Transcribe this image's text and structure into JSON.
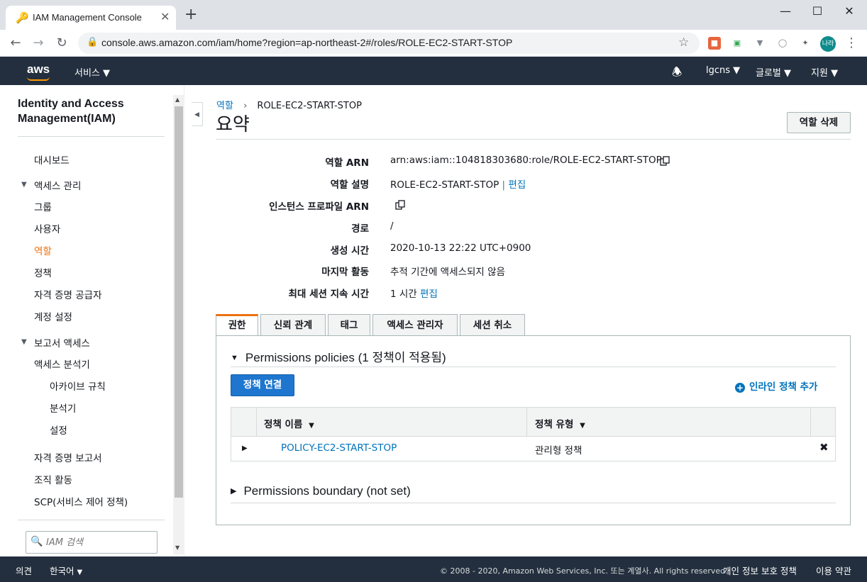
{
  "browser": {
    "tab_title": "IAM Management Console",
    "url": "console.aws.amazon.com/iam/home?region=ap-northeast-2#/roles/ROLE-EC2-START-STOP",
    "profile_label": "나라"
  },
  "aws_nav": {
    "logo": "aws",
    "services": "서비스",
    "account": "lgcns",
    "region": "글로벌",
    "support": "지원"
  },
  "sidebar": {
    "title": "Identity and Access Management(IAM)",
    "dashboard": "대시보드",
    "access_mgmt": "액세스 관리",
    "items_access": [
      "그룹",
      "사용자",
      "역할",
      "정책",
      "자격 증명 공급자",
      "계정 설정"
    ],
    "report_access": "보고서 액세스",
    "analyzer": "액세스 분석기",
    "analyzer_sub": [
      "아카이브 규칙",
      "분석기",
      "설정"
    ],
    "items_report": [
      "자격 증명 보고서",
      "조직 활동",
      "SCP(서비스 제어 정책)"
    ],
    "search_placeholder": "IAM 검색"
  },
  "breadcrumb": {
    "parent": "역할",
    "current": "ROLE-EC2-START-STOP"
  },
  "page_title": "요약",
  "delete_button": "역할 삭제",
  "summary": {
    "arn_label": "역할 ARN",
    "arn_value": "arn:aws:iam::104818303680:role/ROLE-EC2-START-STOP",
    "desc_label": "역할 설명",
    "desc_value": "ROLE-EC2-START-STOP",
    "desc_sep": "|",
    "edit": "편집",
    "instance_label": "인스턴스 프로파일 ARN",
    "path_label": "경로",
    "path_value": "/",
    "created_label": "생성 시간",
    "created_value": "2020-10-13 22:22 UTC+0900",
    "last_label": "마지막 활동",
    "last_value": "추적 기간에 액세스되지 않음",
    "session_label": "최대 세션 지속 시간",
    "session_value": "1 시간"
  },
  "tabs": [
    "권한",
    "신뢰 관계",
    "태그",
    "액세스 관리자",
    "세션 취소"
  ],
  "permissions": {
    "heading": "Permissions policies (1 정책이 적용됨)",
    "attach_button": "정책 연결",
    "inline_add": "인라인 정책 추가",
    "col_name": "정책 이름",
    "col_type": "정책 유형",
    "rows": [
      {
        "name": "POLICY-EC2-START-STOP",
        "type": "관리형 정책"
      }
    ],
    "boundary": "Permissions boundary (not set)"
  },
  "footer": {
    "feedback": "의견",
    "language": "한국어",
    "copyright": "© 2008 - 2020, Amazon Web Services, Inc. 또는 계열사. All rights reserved.",
    "privacy": "개인 정보 보호 정책",
    "terms": "이용 약관"
  }
}
